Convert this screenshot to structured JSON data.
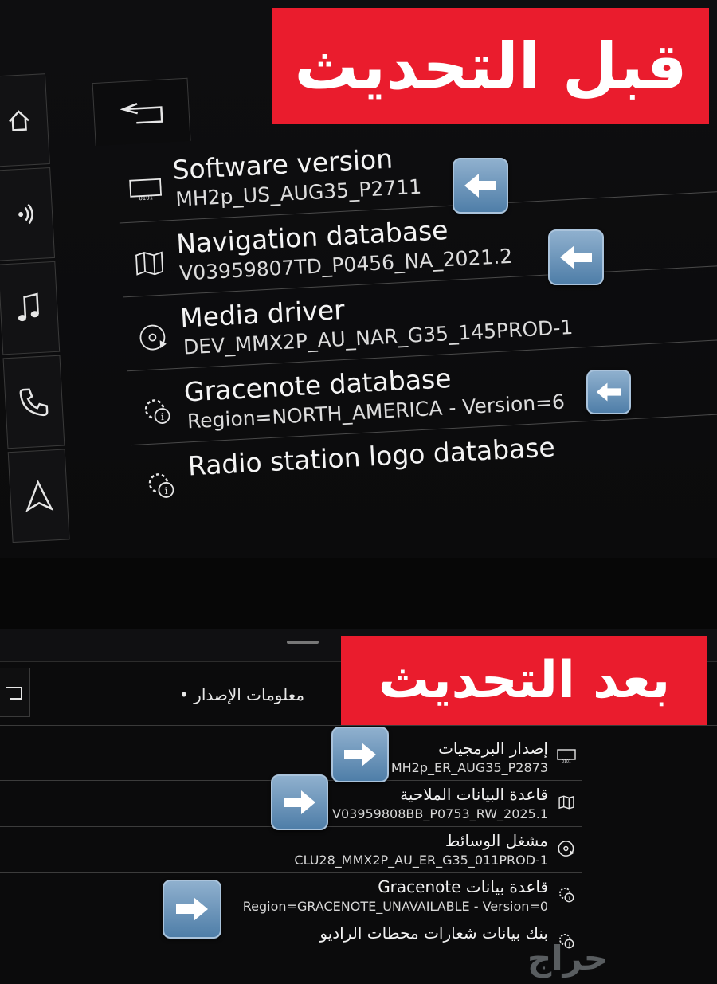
{
  "top_panel": {
    "banner_text": "قبل التحديث",
    "items": [
      {
        "title": "Software version",
        "value": "MH2p_US_AUG35_P2711",
        "icon": "software-icon"
      },
      {
        "title": "Navigation database",
        "value": "V03959807TD_P0456_NA_2021.2",
        "icon": "map-icon"
      },
      {
        "title": "Media driver",
        "value": "DEV_MMX2P_AU_NAR_G35_145PROD-1",
        "icon": "media-disc-icon"
      },
      {
        "title": "Gracenote database",
        "value": "Region=NORTH_AMERICA - Version=6",
        "icon": "gear-info-icon"
      },
      {
        "title": "Radio station logo database",
        "value": "",
        "icon": "gear-info-icon"
      }
    ],
    "sidebar_icons": [
      "home-icon",
      "radio-icon",
      "music-note-icon",
      "phone-icon",
      "navigation-arrow-icon"
    ]
  },
  "bottom_panel": {
    "banner_text": "بعد التحديث",
    "breadcrumb": "معلومات الإصدار •",
    "items": [
      {
        "title": "إصدار البرمجيات",
        "value": "MH2p_ER_AUG35_P2873",
        "icon": "software-icon"
      },
      {
        "title": "قاعدة البيانات الملاحية",
        "value": "V03959808BB_P0753_RW_2025.1",
        "icon": "map-icon"
      },
      {
        "title": "مشغل الوسائط",
        "value": "CLU28_MMX2P_AU_ER_G35_011PROD-1",
        "icon": "media-disc-icon"
      },
      {
        "title": "قاعدة بيانات Gracenote",
        "value": "Region=GRACENOTE_UNAVAILABLE - Version=0",
        "icon": "gear-info-icon"
      },
      {
        "title": "بنك بيانات شعارات محطات الراديو",
        "value": "",
        "icon": "gear-info-icon"
      }
    ]
  },
  "watermark": "حراج",
  "colors": {
    "banner_red": "#ea1c2d",
    "arrow_button_blue": "#5f8ab2",
    "screen_bg": "#0b0b0c"
  }
}
